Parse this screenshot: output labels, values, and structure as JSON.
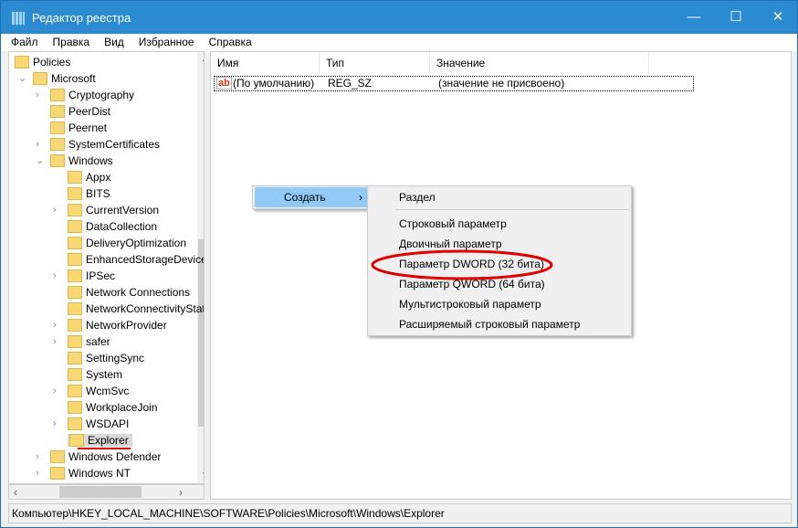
{
  "window": {
    "title": "Редактор реестра",
    "minimize": "—",
    "maximize": "☐",
    "close": "✕"
  },
  "menu": [
    "Файл",
    "Правка",
    "Вид",
    "Избранное",
    "Справка"
  ],
  "tree": [
    {
      "label": "Policies",
      "level": 0,
      "chevron": ""
    },
    {
      "label": "Microsoft",
      "level": 1,
      "chevron": "expanded"
    },
    {
      "label": "Cryptography",
      "level": 2,
      "chevron": "collapsed"
    },
    {
      "label": "PeerDist",
      "level": 2,
      "chevron": ""
    },
    {
      "label": "Peernet",
      "level": 2,
      "chevron": ""
    },
    {
      "label": "SystemCertificates",
      "level": 2,
      "chevron": "collapsed"
    },
    {
      "label": "Windows",
      "level": 2,
      "chevron": "expanded"
    },
    {
      "label": "Appx",
      "level": 3,
      "chevron": ""
    },
    {
      "label": "BITS",
      "level": 3,
      "chevron": ""
    },
    {
      "label": "CurrentVersion",
      "level": 3,
      "chevron": "collapsed"
    },
    {
      "label": "DataCollection",
      "level": 3,
      "chevron": ""
    },
    {
      "label": "DeliveryOptimization",
      "level": 3,
      "chevron": ""
    },
    {
      "label": "EnhancedStorageDevices",
      "level": 3,
      "chevron": ""
    },
    {
      "label": "IPSec",
      "level": 3,
      "chevron": "collapsed"
    },
    {
      "label": "Network Connections",
      "level": 3,
      "chevron": ""
    },
    {
      "label": "NetworkConnectivityStatusIndicator",
      "level": 3,
      "chevron": ""
    },
    {
      "label": "NetworkProvider",
      "level": 3,
      "chevron": "collapsed"
    },
    {
      "label": "safer",
      "level": 3,
      "chevron": "collapsed"
    },
    {
      "label": "SettingSync",
      "level": 3,
      "chevron": ""
    },
    {
      "label": "System",
      "level": 3,
      "chevron": ""
    },
    {
      "label": "WcmSvc",
      "level": 3,
      "chevron": "collapsed"
    },
    {
      "label": "WorkplaceJoin",
      "level": 3,
      "chevron": ""
    },
    {
      "label": "WSDAPI",
      "level": 3,
      "chevron": "collapsed"
    },
    {
      "label": "Explorer",
      "level": 3,
      "chevron": "",
      "selected": true
    },
    {
      "label": "Windows Defender",
      "level": 2,
      "chevron": "collapsed"
    },
    {
      "label": "Windows NT",
      "level": 2,
      "chevron": "collapsed"
    }
  ],
  "columns": [
    "Имя",
    "Тип",
    "Значение"
  ],
  "values": [
    {
      "name": "(По умолчанию)",
      "type": "REG_SZ",
      "data": "(значение не присвоено)",
      "icon": "ab"
    }
  ],
  "context_menu": {
    "create": "Создать",
    "submenu": [
      "Раздел",
      "Строковый параметр",
      "Двоичный параметр",
      "Параметр DWORD (32 бита)",
      "Параметр QWORD (64 бита)",
      "Мультистроковый параметр",
      "Расширяемый строковый параметр"
    ]
  },
  "status": "Компьютер\\HKEY_LOCAL_MACHINE\\SOFTWARE\\Policies\\Microsoft\\Windows\\Explorer",
  "colors": {
    "titlebar": "#2b8ad0",
    "highlight": "#91c9f7",
    "annotation": "#e00000"
  }
}
